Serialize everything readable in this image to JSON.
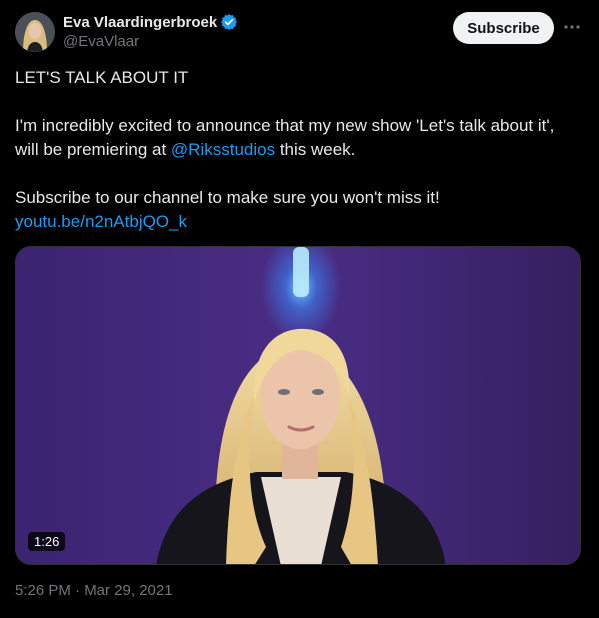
{
  "author": {
    "name": "Eva Vlaardingerbroek",
    "handle": "@EvaVlaar",
    "verified_color": "#1d9bf0"
  },
  "actions": {
    "subscribe_label": "Subscribe",
    "more_icon": "more-horizontal-icon"
  },
  "post": {
    "line1": "LET'S TALK ABOUT IT",
    "para2_before": "I'm incredibly excited to announce that my new show 'Let's talk about it', will be premiering at ",
    "mention": "@Riksstudios",
    "para2_after": " this week.",
    "para3_before": "Subscribe to our channel to make sure you won't miss it! ",
    "link": "youtu.be/n2nAtbjQO_k"
  },
  "media": {
    "duration": "1:26",
    "accent_color": "#4a2d86"
  },
  "timestamp": "5:26 PM · Mar 29, 2021",
  "colors": {
    "background": "#000000",
    "text": "#e7e9ea",
    "muted": "#71767b",
    "link": "#1d9bf0"
  }
}
